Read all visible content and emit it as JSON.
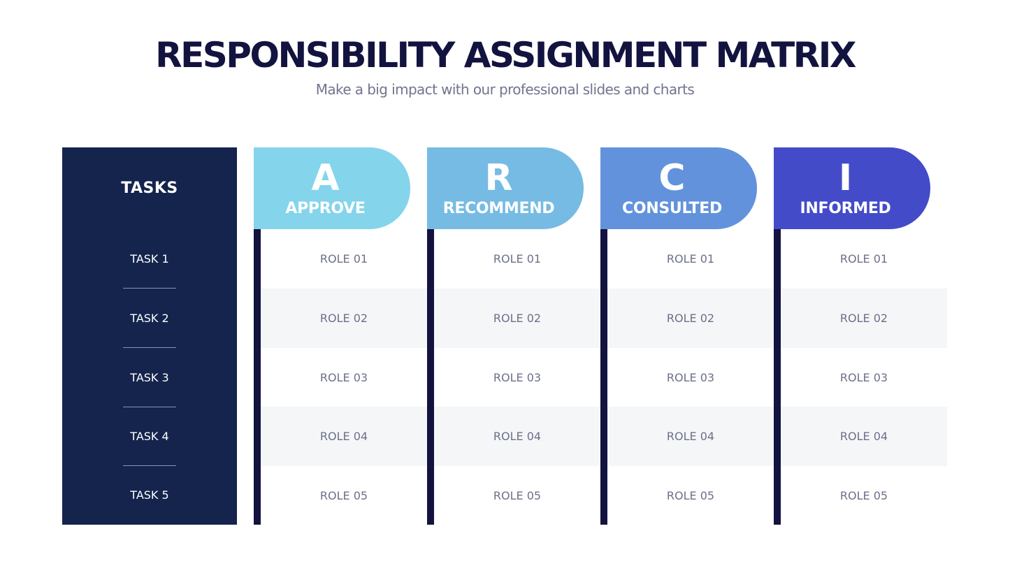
{
  "title": "RESPONSIBILITY ASSIGNMENT MATRIX",
  "subtitle": "Make a big impact with our professional slides and charts",
  "tasks_header": "TASKS",
  "tasks": [
    "TASK 1",
    "TASK 2",
    "TASK 3",
    "TASK 4",
    "TASK 5"
  ],
  "columns": [
    {
      "letter": "A",
      "label": "APPROVE",
      "color": "#84d4ec",
      "roles": [
        "ROLE 01",
        "ROLE 02",
        "ROLE 03",
        "ROLE 04",
        "ROLE 05"
      ]
    },
    {
      "letter": "R",
      "label": "RECOMMEND",
      "color": "#76bbe3",
      "roles": [
        "ROLE 01",
        "ROLE 02",
        "ROLE 03",
        "ROLE 04",
        "ROLE 05"
      ]
    },
    {
      "letter": "C",
      "label": "CONSULTED",
      "color": "#6292dc",
      "roles": [
        "ROLE 01",
        "ROLE 02",
        "ROLE 03",
        "ROLE 04",
        "ROLE 05"
      ]
    },
    {
      "letter": "I",
      "label": "INFORMED",
      "color": "#434bc9",
      "roles": [
        "ROLE 01",
        "ROLE 02",
        "ROLE 03",
        "ROLE 04",
        "ROLE 05"
      ]
    }
  ],
  "colors": {
    "panel": "#15244d",
    "title": "#12133f",
    "stripe": "#f4f6f8",
    "role_text": "#6c7088"
  }
}
